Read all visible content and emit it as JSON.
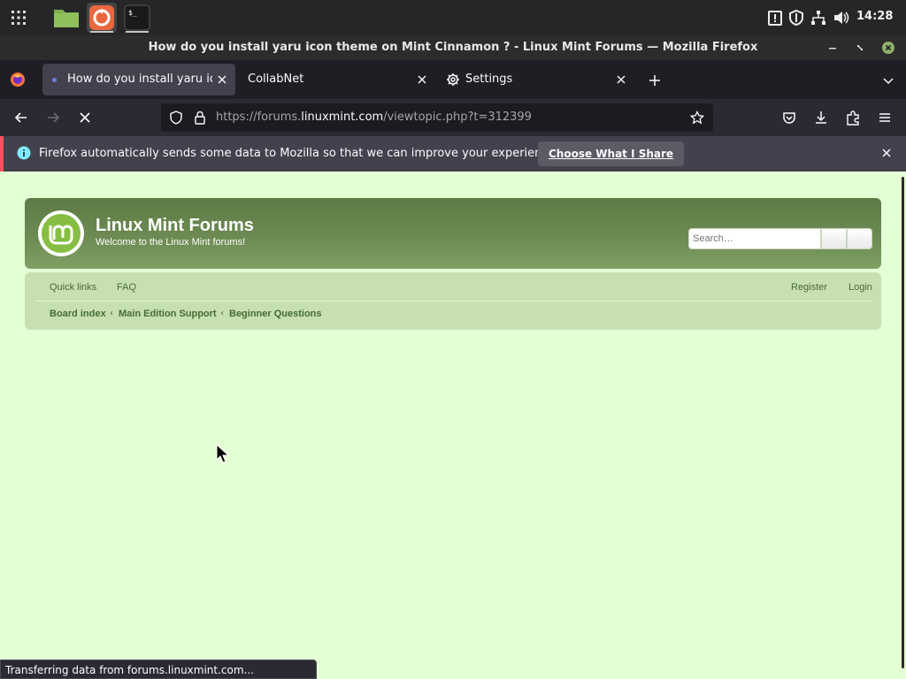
{
  "taskbar": {
    "clock": "14:28",
    "apps": [
      "app-grid-icon",
      "files-icon",
      "software-manager-icon",
      "terminal-icon"
    ],
    "terminal_glyph": "$_"
  },
  "window": {
    "title": "How do you install yaru icon theme on Mint Cinnamon ? - Linux Mint Forums — Mozilla Firefox"
  },
  "tabs": [
    {
      "label": "How do you install yaru icon theme on Mint Cinnamon ?",
      "active": true
    },
    {
      "label": "CollabNet",
      "active": false
    },
    {
      "label": "Settings",
      "active": false
    }
  ],
  "urlbar": {
    "scheme": "https://forums.",
    "host": "linuxmint.com",
    "path": "/viewtopic.php?t=312399"
  },
  "notification": {
    "text": "Firefox automatically sends some data to Mozilla so that we can improve your experience.",
    "button": "Choose What I Share"
  },
  "forum": {
    "title": "Linux Mint Forums",
    "description": "Welcome to the Linux Mint forums!",
    "search_placeholder": "Search…",
    "links": {
      "quick_links": "Quick links",
      "faq": "FAQ",
      "register": "Register",
      "login": "Login"
    },
    "breadcrumbs": [
      "Board index",
      "Main Edition Support",
      "Beginner Questions"
    ]
  },
  "status": {
    "text": "Transferring data from forums.linuxmint.com..."
  },
  "colors": {
    "page_bg": "#e4ffd4",
    "header_green": "#6c8a52",
    "accent_red": "#ff4f5e"
  }
}
